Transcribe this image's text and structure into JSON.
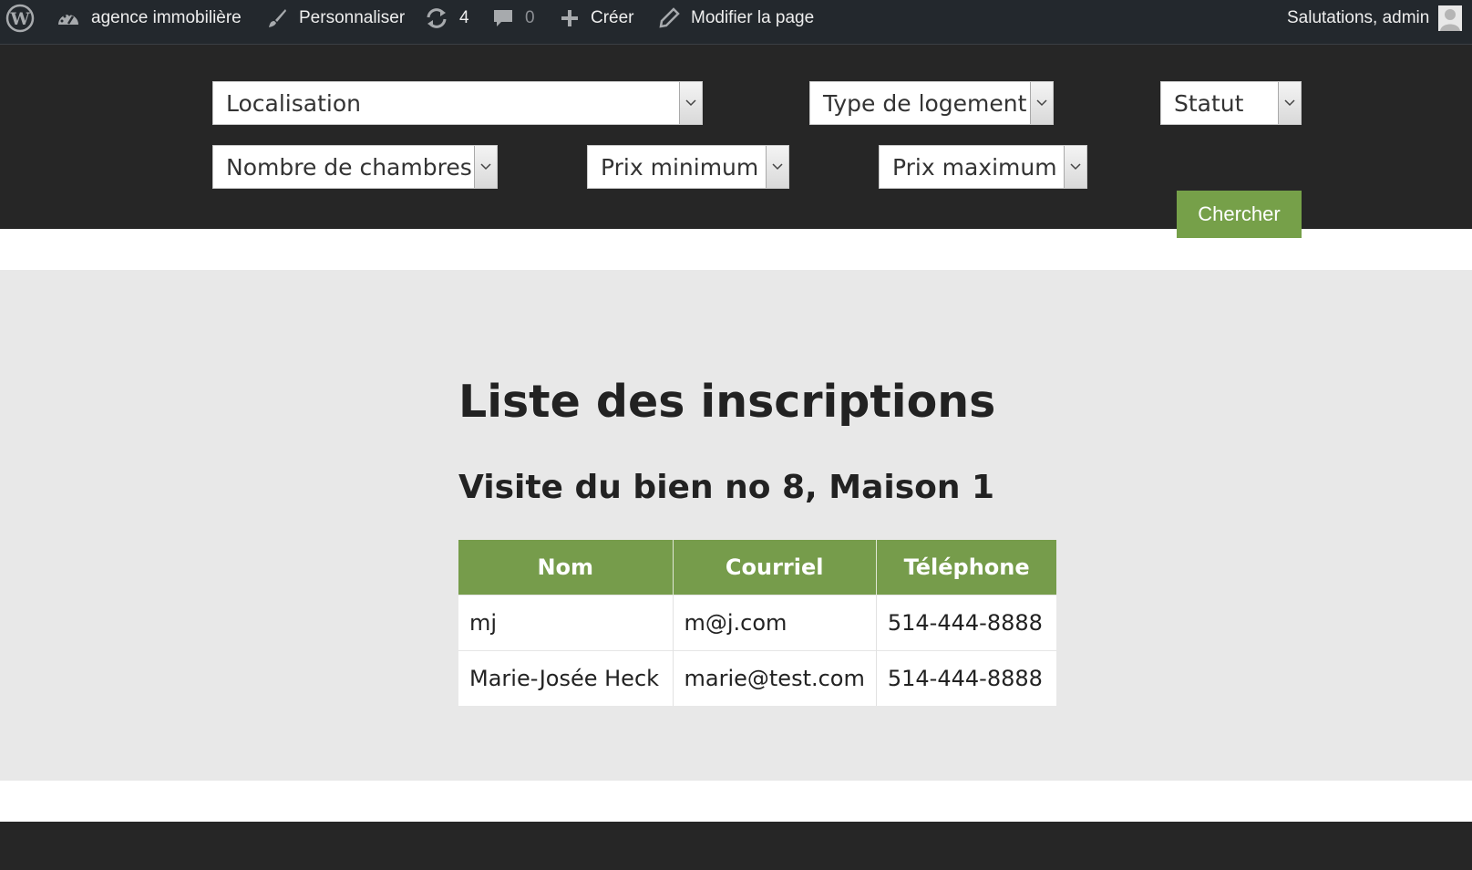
{
  "adminbar": {
    "site_name": "agence immobilière",
    "customize_label": "Personnaliser",
    "updates_count": "4",
    "comments_count": "0",
    "new_label": "Créer",
    "edit_label": "Modifier la page",
    "greeting": "Salutations, admin",
    "icons": [
      "wordpress-logo-icon",
      "dashboard-icon",
      "brush-icon",
      "refresh-icon",
      "comment-icon",
      "plus-icon",
      "pencil-icon",
      "avatar-icon"
    ]
  },
  "search": {
    "location": "Localisation",
    "type": "Type de logement",
    "status": "Statut",
    "bedrooms": "Nombre de chambres",
    "min_price": "Prix minimum",
    "max_price": "Prix maximum",
    "button": "Chercher",
    "button_color": "#76a049"
  },
  "main": {
    "title": "Liste des inscriptions",
    "subtitle": "Visite du bien no 8, Maison 1",
    "table": {
      "headers": [
        "Nom",
        "Courriel",
        "Téléphone"
      ],
      "rows": [
        [
          "mj",
          "m@j.com",
          "514-444-8888"
        ],
        [
          "Marie-Josée Heck",
          "marie@test.com",
          "514-444-8888"
        ]
      ]
    }
  },
  "colors": {
    "admin_bar": "#23282d",
    "header": "#262626",
    "content_bg": "#e8e8e8",
    "accent_green": "#769c4b"
  }
}
